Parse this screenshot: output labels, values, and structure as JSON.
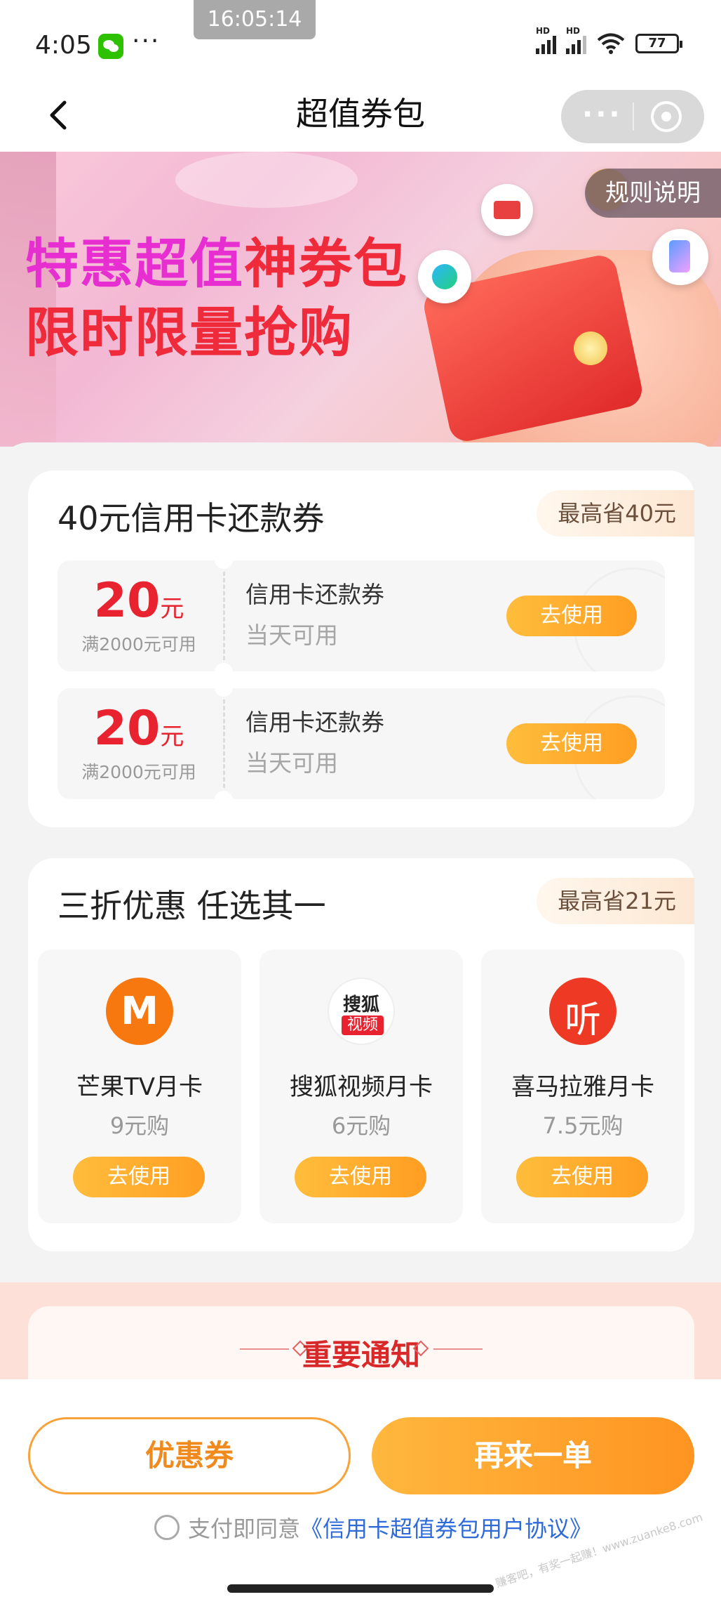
{
  "status_bar": {
    "time": "4:05",
    "more": "···",
    "overlay_time": "16:05:14",
    "net1": "HD",
    "net2": "HD",
    "battery": "77"
  },
  "nav": {
    "title": "超值券包",
    "capsule_more": "···"
  },
  "banner": {
    "line1_part1": "特惠超值",
    "line1_part2": "神券包",
    "line2": "限时限量抢购",
    "rules": "规则说明"
  },
  "credit_section": {
    "title": "40元信用卡还款券",
    "save": "最高省40元",
    "coupons": [
      {
        "amount": "20",
        "unit": "元",
        "condition": "满2000元可用",
        "name": "信用卡还款券",
        "validity": "当天可用",
        "button": "去使用"
      },
      {
        "amount": "20",
        "unit": "元",
        "condition": "满2000元可用",
        "name": "信用卡还款券",
        "validity": "当天可用",
        "button": "去使用"
      }
    ]
  },
  "discount_section": {
    "title": "三折优惠 任选其一",
    "save": "最高省21元",
    "options": [
      {
        "icon": "mango-tv-icon",
        "title": "芒果TV月卡",
        "price": "9元购",
        "button": "去使用"
      },
      {
        "icon": "sohu-video-icon",
        "logo_line1": "搜狐",
        "logo_line2": "视频",
        "title": "搜狐视频月卡",
        "price": "6元购",
        "button": "去使用"
      },
      {
        "icon": "ximalaya-icon",
        "title": "喜马拉雅月卡",
        "price": "7.5元购",
        "button": "去使用"
      }
    ]
  },
  "notice": {
    "title": "重要通知"
  },
  "bottom": {
    "coupon_button": "优惠券",
    "again_button": "再来一单",
    "agree_text": "支付即同意",
    "agree_link": "《信用卡超值券包用户协议》",
    "watermark": "赚客吧，有奖一起赚！www.zuanke8.com"
  },
  "colors": {
    "accent_orange": "#ff9e22",
    "price_red": "#e8232f",
    "link_blue": "#2f6bd8"
  }
}
